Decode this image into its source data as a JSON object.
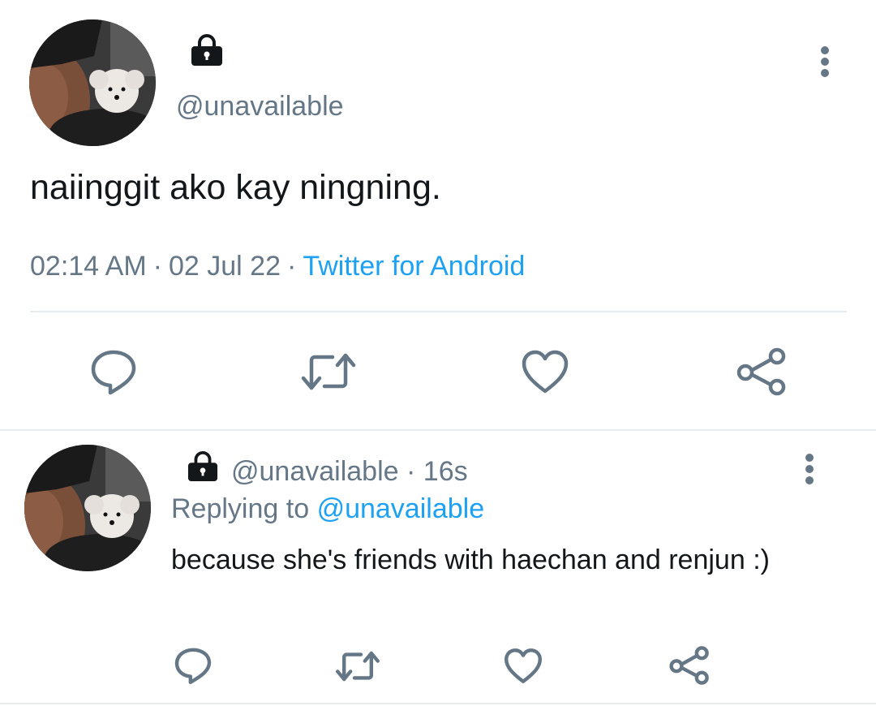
{
  "main_tweet": {
    "handle": "@unavailable",
    "text": "naiinggit ako kay ningning.",
    "time": "02:14 AM",
    "separator": "·",
    "date": "02 Jul 22",
    "source": "Twitter for Android",
    "protected_icon": "lock-icon",
    "more_icon": "more-vertical-icon"
  },
  "reply_tweet": {
    "handle": "@unavailable",
    "separator": "·",
    "age": "16s",
    "replying_label": "Replying to",
    "replying_to": "@unavailable",
    "text": "because she's friends with haechan and renjun :)",
    "protected_icon": "lock-icon",
    "more_icon": "more-vertical-icon"
  },
  "actions": [
    "reply-icon",
    "retweet-icon",
    "like-icon",
    "share-icon"
  ],
  "colors": {
    "text": "#14171a",
    "secondary": "#657786",
    "accent": "#1da1f2",
    "divider": "#e6ecf0"
  }
}
